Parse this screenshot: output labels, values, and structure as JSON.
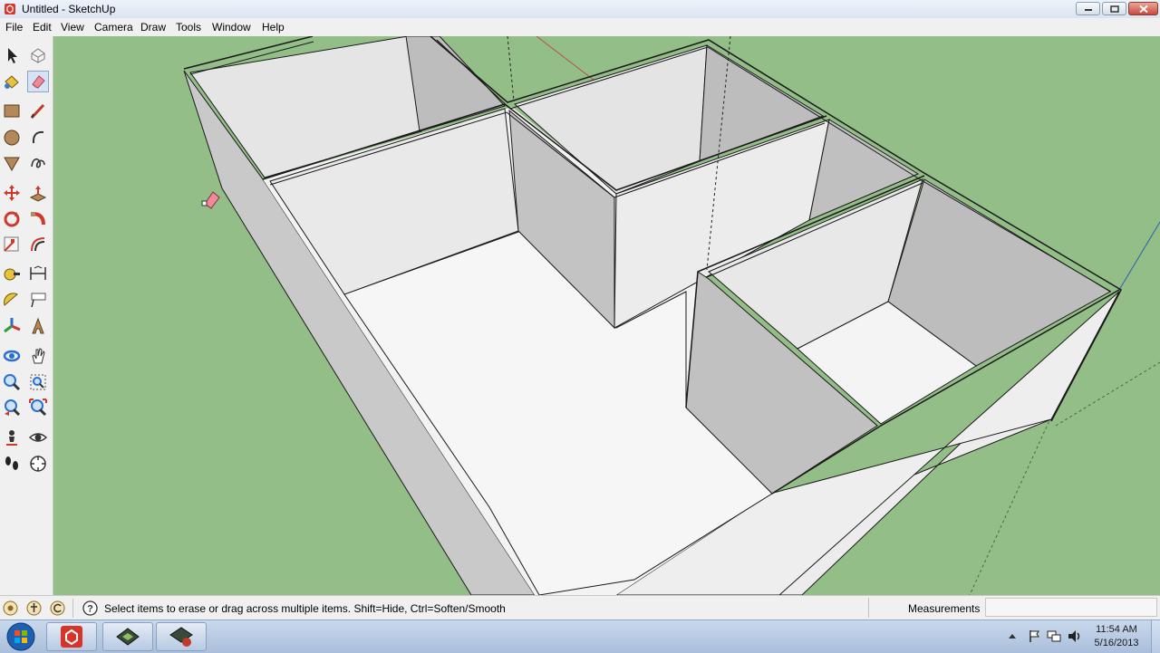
{
  "window": {
    "title": "Untitled - SketchUp",
    "app_icon": "sketchup-app-icon",
    "controls": [
      "minimize-icon",
      "maximize-icon",
      "close-icon"
    ]
  },
  "menu": {
    "items": [
      "File",
      "Edit",
      "View",
      "Camera",
      "Draw",
      "Tools",
      "Window",
      "Help"
    ]
  },
  "toolbar": {
    "tools": [
      "select-tool-icon",
      "make-component-icon",
      "paint-bucket-icon",
      "eraser-icon",
      "rectangle-icon",
      "line-icon",
      "circle-icon",
      "arc-icon",
      "polygon-icon",
      "freehand-icon",
      "move-icon",
      "push-pull-icon",
      "rotate-icon",
      "follow-me-icon",
      "scale-icon",
      "offset-icon",
      "tape-measure-icon",
      "dimension-icon",
      "protractor-icon",
      "text-icon",
      "axes-icon",
      "3d-text-icon",
      "orbit-icon",
      "pan-icon",
      "zoom-icon",
      "zoom-window-icon",
      "previous-view-icon",
      "zoom-extents-icon",
      "position-camera-icon",
      "look-around-icon",
      "walk-icon",
      "section-plane-icon"
    ],
    "active_tool": "eraser-icon"
  },
  "viewport": {
    "ground_color": "#93be87",
    "wall_face_color": "#eeeeee",
    "wall_shade_color": "#bdbdbd",
    "cursor": "eraser-cursor-icon"
  },
  "status": {
    "icons": [
      "geo-location-icon",
      "credits-icon",
      "sign-in-icon"
    ],
    "help_icon": "help-icon",
    "message": "Select items to erase or drag across multiple items. Shift=Hide, Ctrl=Soften/Smooth",
    "measurements_label": "Measurements",
    "measurements_value": ""
  },
  "taskbar": {
    "start_icon": "windows-start-orb-icon",
    "buttons": [
      "sketchup-taskbar-icon",
      "layout-taskbar-icon",
      "style-builder-taskbar-icon"
    ],
    "tray": [
      "show-hidden-icons-icon",
      "action-center-flag-icon",
      "network-icon",
      "volume-icon"
    ],
    "time": "11:54 AM",
    "date": "5/16/2013"
  }
}
